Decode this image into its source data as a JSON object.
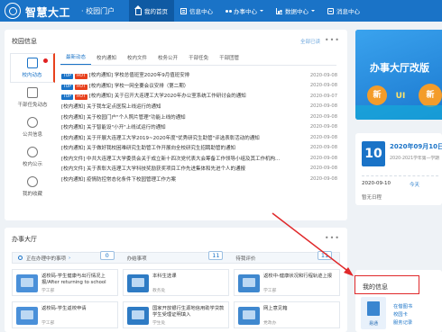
{
  "header": {
    "site_title": "智慧大工",
    "site_subtitle": "· 校园门户",
    "nav": [
      {
        "label": "我的首页",
        "icon": "home-icon",
        "active": true
      },
      {
        "label": "信息中心",
        "icon": "info-icon"
      },
      {
        "label": "办事中心",
        "icon": "office-icon",
        "dropdown": true
      },
      {
        "label": "数据中心",
        "icon": "data-icon",
        "dropdown": true
      },
      {
        "label": "消息中心",
        "icon": "message-icon"
      }
    ],
    "color": "#1a73c7"
  },
  "campus_info": {
    "title": "校园信息",
    "mark_all_read": "全部已读",
    "side_menu": [
      {
        "label": "校内动态",
        "active": true,
        "has_alert": true
      },
      {
        "label": "干部任免动态"
      },
      {
        "label": "公共信息"
      },
      {
        "label": "校内公示"
      },
      {
        "label": "我的收藏"
      }
    ],
    "tabs": [
      "最新动态",
      "校内通知",
      "校内文件",
      "校务公开",
      "干部任免",
      "干部团管"
    ],
    "news": [
      {
        "tags": [
          "TOP",
          "HOT"
        ],
        "text": "[校内通知] 学校总值班室2020年9月值班安排",
        "date": "2020-09-08"
      },
      {
        "tags": [
          "TOP",
          "HOT"
        ],
        "text": "[校内通知] 学校一网全要会议安排（第二期）",
        "date": "2020-09-08"
      },
      {
        "tags": [
          "TOP",
          "HOT"
        ],
        "text": "[校内通知] 关于召开大连理工大学2020年办公室系统工作研讨会的通知",
        "date": "2020-09-07"
      },
      {
        "tags": [],
        "text": "[校内通知] 关于我车定点医院上线运行的通知",
        "date": "2020-09-08"
      },
      {
        "tags": [],
        "text": "[校内通知] 关于校园门户\"个人照片管理\"功能上线的通知",
        "date": "2020-09-08"
      },
      {
        "tags": [],
        "text": "[校内通知] 关于智能设\"小开\"上线试运行的通知",
        "date": "2020-09-08"
      },
      {
        "tags": [],
        "text": "[校内通知] 关于开展大连理工大学2019~2020年度\"优秀研究生助管\"评选表彰活动的通知",
        "date": "2020-09-08"
      },
      {
        "tags": [],
        "text": "[校内通知] 关于做好我校困难研究生助管工作开展向全校研究生招聘助管的通知",
        "date": "2020-09-08"
      },
      {
        "tags": [],
        "text": "[校内文件] 中共大连理工大学委员会关于成立新十四次党代表大会筹备工作领导小组及其工作机构...",
        "date": "2020-09-08"
      },
      {
        "tags": [],
        "text": "[校内文件] 关于表彰大连理工大学科技奖励获奖项目工作先进集体和先进个人的通报",
        "date": "2020-09-08"
      },
      {
        "tags": [],
        "text": "[校内通知] 疫情防控常态化条件下校园管理工作方案",
        "date": "2020-09-08"
      }
    ]
  },
  "office_hall": {
    "title": "办事大厅",
    "stats": [
      {
        "label": "正在办理中的事项",
        "value": "0",
        "link": true
      },
      {
        "label": "办结事项",
        "value": "11"
      },
      {
        "label": "待我评价",
        "value": "11"
      }
    ],
    "cards": [
      {
        "title": "返校码-学生健康与出行情况上报/After returning to school",
        "sub": "学工部"
      },
      {
        "title": "本科生选课",
        "sub": "教务处"
      },
      {
        "title": "返校中-健康状况和行程轨迹上报",
        "sub": "学工部"
      },
      {
        "title": "返校码-学生返校申请",
        "sub": "学工部"
      },
      {
        "title": "国家开放银行生源地信用助学贷款学生受理证明填入",
        "sub": "学生处"
      },
      {
        "title": "网上意见箱",
        "sub": "党政办"
      }
    ]
  },
  "banner": {
    "title": "办事大厅改版",
    "badges": [
      "新",
      "UI",
      "新"
    ]
  },
  "calendar": {
    "day": "10",
    "date": "2020年09月10日",
    "term": "2020-2021学年第一学期",
    "current_time": "2020-09-10",
    "today_label": "今天",
    "empty": "暂无日程"
  },
  "mine": {
    "title": "我的信息",
    "download_label": "易通",
    "links": [
      "在借图书",
      "校园卡",
      "服务记录"
    ]
  },
  "annotation": {
    "highlight_color": "#e0282a"
  }
}
